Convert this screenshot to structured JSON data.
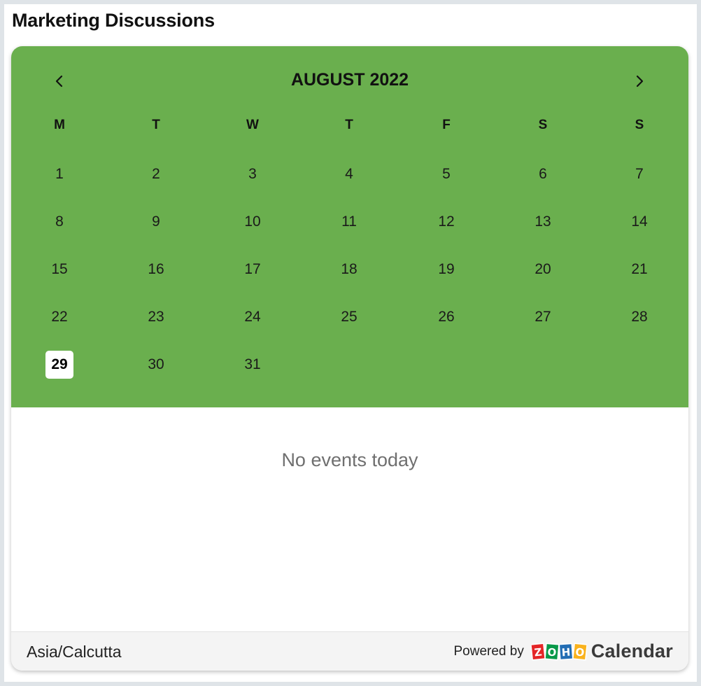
{
  "widget": {
    "title": "Marketing Discussions"
  },
  "calendar": {
    "month_label": "AUGUST 2022",
    "prev_label": "‹",
    "next_label": "›",
    "accent_color": "#6aaf4e",
    "weekdays": [
      "M",
      "T",
      "W",
      "T",
      "F",
      "S",
      "S"
    ],
    "weeks": [
      [
        "1",
        "2",
        "3",
        "4",
        "5",
        "6",
        "7"
      ],
      [
        "8",
        "9",
        "10",
        "11",
        "12",
        "13",
        "14"
      ],
      [
        "15",
        "16",
        "17",
        "18",
        "19",
        "20",
        "21"
      ],
      [
        "22",
        "23",
        "24",
        "25",
        "26",
        "27",
        "28"
      ],
      [
        "29",
        "30",
        "31"
      ]
    ],
    "today": "29"
  },
  "events": {
    "empty_message": "No events today"
  },
  "footer": {
    "timezone": "Asia/Calcutta",
    "powered_by": "Powered by",
    "brand_logo": "ZOHO",
    "brand_product": "Calendar"
  }
}
